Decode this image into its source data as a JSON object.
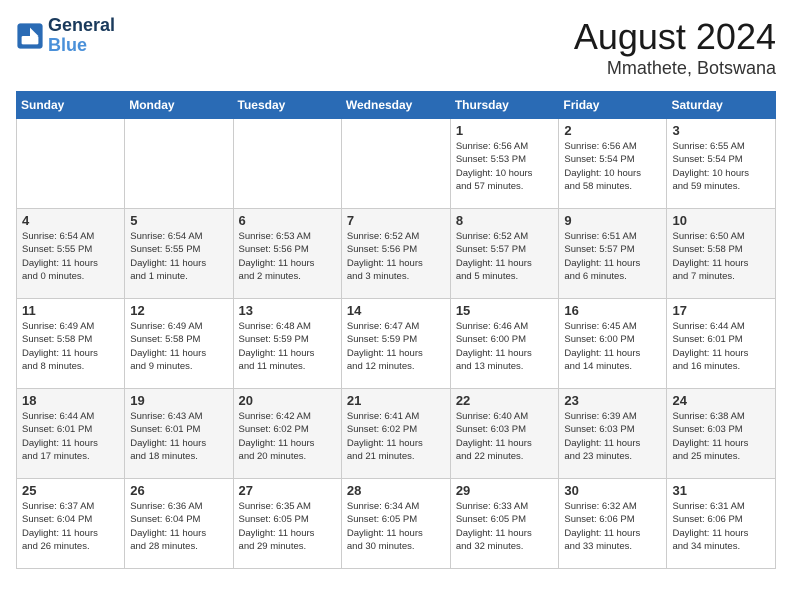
{
  "header": {
    "logo_line1": "General",
    "logo_line2": "Blue",
    "month": "August 2024",
    "location": "Mmathete, Botswana"
  },
  "weekdays": [
    "Sunday",
    "Monday",
    "Tuesday",
    "Wednesday",
    "Thursday",
    "Friday",
    "Saturday"
  ],
  "weeks": [
    [
      {
        "day": "",
        "info": ""
      },
      {
        "day": "",
        "info": ""
      },
      {
        "day": "",
        "info": ""
      },
      {
        "day": "",
        "info": ""
      },
      {
        "day": "1",
        "info": "Sunrise: 6:56 AM\nSunset: 5:53 PM\nDaylight: 10 hours\nand 57 minutes."
      },
      {
        "day": "2",
        "info": "Sunrise: 6:56 AM\nSunset: 5:54 PM\nDaylight: 10 hours\nand 58 minutes."
      },
      {
        "day": "3",
        "info": "Sunrise: 6:55 AM\nSunset: 5:54 PM\nDaylight: 10 hours\nand 59 minutes."
      }
    ],
    [
      {
        "day": "4",
        "info": "Sunrise: 6:54 AM\nSunset: 5:55 PM\nDaylight: 11 hours\nand 0 minutes."
      },
      {
        "day": "5",
        "info": "Sunrise: 6:54 AM\nSunset: 5:55 PM\nDaylight: 11 hours\nand 1 minute."
      },
      {
        "day": "6",
        "info": "Sunrise: 6:53 AM\nSunset: 5:56 PM\nDaylight: 11 hours\nand 2 minutes."
      },
      {
        "day": "7",
        "info": "Sunrise: 6:52 AM\nSunset: 5:56 PM\nDaylight: 11 hours\nand 3 minutes."
      },
      {
        "day": "8",
        "info": "Sunrise: 6:52 AM\nSunset: 5:57 PM\nDaylight: 11 hours\nand 5 minutes."
      },
      {
        "day": "9",
        "info": "Sunrise: 6:51 AM\nSunset: 5:57 PM\nDaylight: 11 hours\nand 6 minutes."
      },
      {
        "day": "10",
        "info": "Sunrise: 6:50 AM\nSunset: 5:58 PM\nDaylight: 11 hours\nand 7 minutes."
      }
    ],
    [
      {
        "day": "11",
        "info": "Sunrise: 6:49 AM\nSunset: 5:58 PM\nDaylight: 11 hours\nand 8 minutes."
      },
      {
        "day": "12",
        "info": "Sunrise: 6:49 AM\nSunset: 5:58 PM\nDaylight: 11 hours\nand 9 minutes."
      },
      {
        "day": "13",
        "info": "Sunrise: 6:48 AM\nSunset: 5:59 PM\nDaylight: 11 hours\nand 11 minutes."
      },
      {
        "day": "14",
        "info": "Sunrise: 6:47 AM\nSunset: 5:59 PM\nDaylight: 11 hours\nand 12 minutes."
      },
      {
        "day": "15",
        "info": "Sunrise: 6:46 AM\nSunset: 6:00 PM\nDaylight: 11 hours\nand 13 minutes."
      },
      {
        "day": "16",
        "info": "Sunrise: 6:45 AM\nSunset: 6:00 PM\nDaylight: 11 hours\nand 14 minutes."
      },
      {
        "day": "17",
        "info": "Sunrise: 6:44 AM\nSunset: 6:01 PM\nDaylight: 11 hours\nand 16 minutes."
      }
    ],
    [
      {
        "day": "18",
        "info": "Sunrise: 6:44 AM\nSunset: 6:01 PM\nDaylight: 11 hours\nand 17 minutes."
      },
      {
        "day": "19",
        "info": "Sunrise: 6:43 AM\nSunset: 6:01 PM\nDaylight: 11 hours\nand 18 minutes."
      },
      {
        "day": "20",
        "info": "Sunrise: 6:42 AM\nSunset: 6:02 PM\nDaylight: 11 hours\nand 20 minutes."
      },
      {
        "day": "21",
        "info": "Sunrise: 6:41 AM\nSunset: 6:02 PM\nDaylight: 11 hours\nand 21 minutes."
      },
      {
        "day": "22",
        "info": "Sunrise: 6:40 AM\nSunset: 6:03 PM\nDaylight: 11 hours\nand 22 minutes."
      },
      {
        "day": "23",
        "info": "Sunrise: 6:39 AM\nSunset: 6:03 PM\nDaylight: 11 hours\nand 23 minutes."
      },
      {
        "day": "24",
        "info": "Sunrise: 6:38 AM\nSunset: 6:03 PM\nDaylight: 11 hours\nand 25 minutes."
      }
    ],
    [
      {
        "day": "25",
        "info": "Sunrise: 6:37 AM\nSunset: 6:04 PM\nDaylight: 11 hours\nand 26 minutes."
      },
      {
        "day": "26",
        "info": "Sunrise: 6:36 AM\nSunset: 6:04 PM\nDaylight: 11 hours\nand 28 minutes."
      },
      {
        "day": "27",
        "info": "Sunrise: 6:35 AM\nSunset: 6:05 PM\nDaylight: 11 hours\nand 29 minutes."
      },
      {
        "day": "28",
        "info": "Sunrise: 6:34 AM\nSunset: 6:05 PM\nDaylight: 11 hours\nand 30 minutes."
      },
      {
        "day": "29",
        "info": "Sunrise: 6:33 AM\nSunset: 6:05 PM\nDaylight: 11 hours\nand 32 minutes."
      },
      {
        "day": "30",
        "info": "Sunrise: 6:32 AM\nSunset: 6:06 PM\nDaylight: 11 hours\nand 33 minutes."
      },
      {
        "day": "31",
        "info": "Sunrise: 6:31 AM\nSunset: 6:06 PM\nDaylight: 11 hours\nand 34 minutes."
      }
    ]
  ]
}
